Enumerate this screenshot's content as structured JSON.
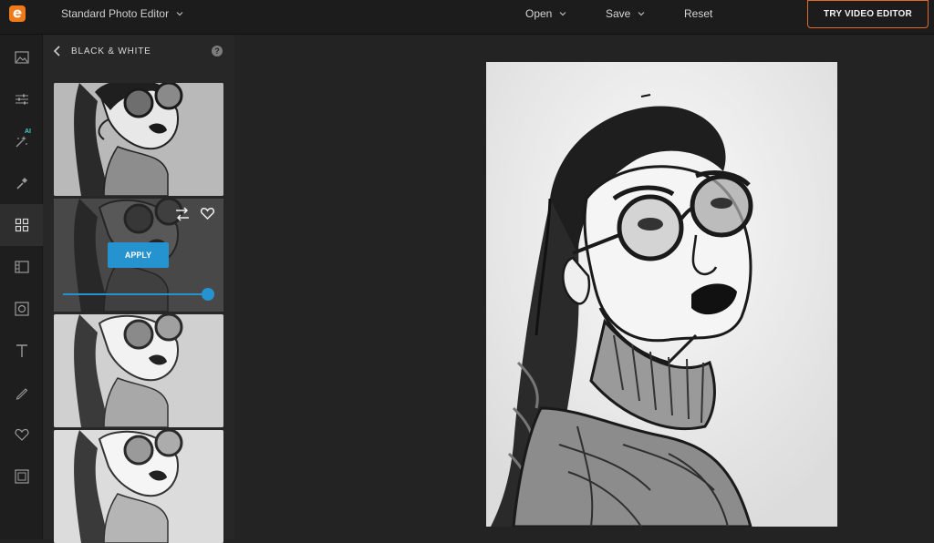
{
  "app": {
    "editor_mode": "Standard Photo Editor",
    "logo": "brand-logo-icon"
  },
  "menu": {
    "open": "Open",
    "save": "Save",
    "reset": "Reset",
    "try_video": "TRY VIDEO EDITOR"
  },
  "rail": {
    "items": [
      {
        "icon": "image-icon"
      },
      {
        "icon": "adjustments-icon"
      },
      {
        "icon": "ai-magic-icon",
        "badge": "AI"
      },
      {
        "icon": "touch-up-icon"
      },
      {
        "icon": "effects-grid-icon"
      },
      {
        "icon": "frames-icon"
      },
      {
        "icon": "overlays-icon"
      },
      {
        "icon": "text-icon"
      },
      {
        "icon": "draw-icon"
      },
      {
        "icon": "favorites-icon"
      },
      {
        "icon": "border-icon"
      }
    ]
  },
  "panel": {
    "title": "BLACK & WHITE",
    "help": "?",
    "apply": "APPLY",
    "intensity": 1.0
  },
  "colors": {
    "accent": "#2493cf",
    "brand": "#e06a2c",
    "ai": "#3fd0c9"
  }
}
